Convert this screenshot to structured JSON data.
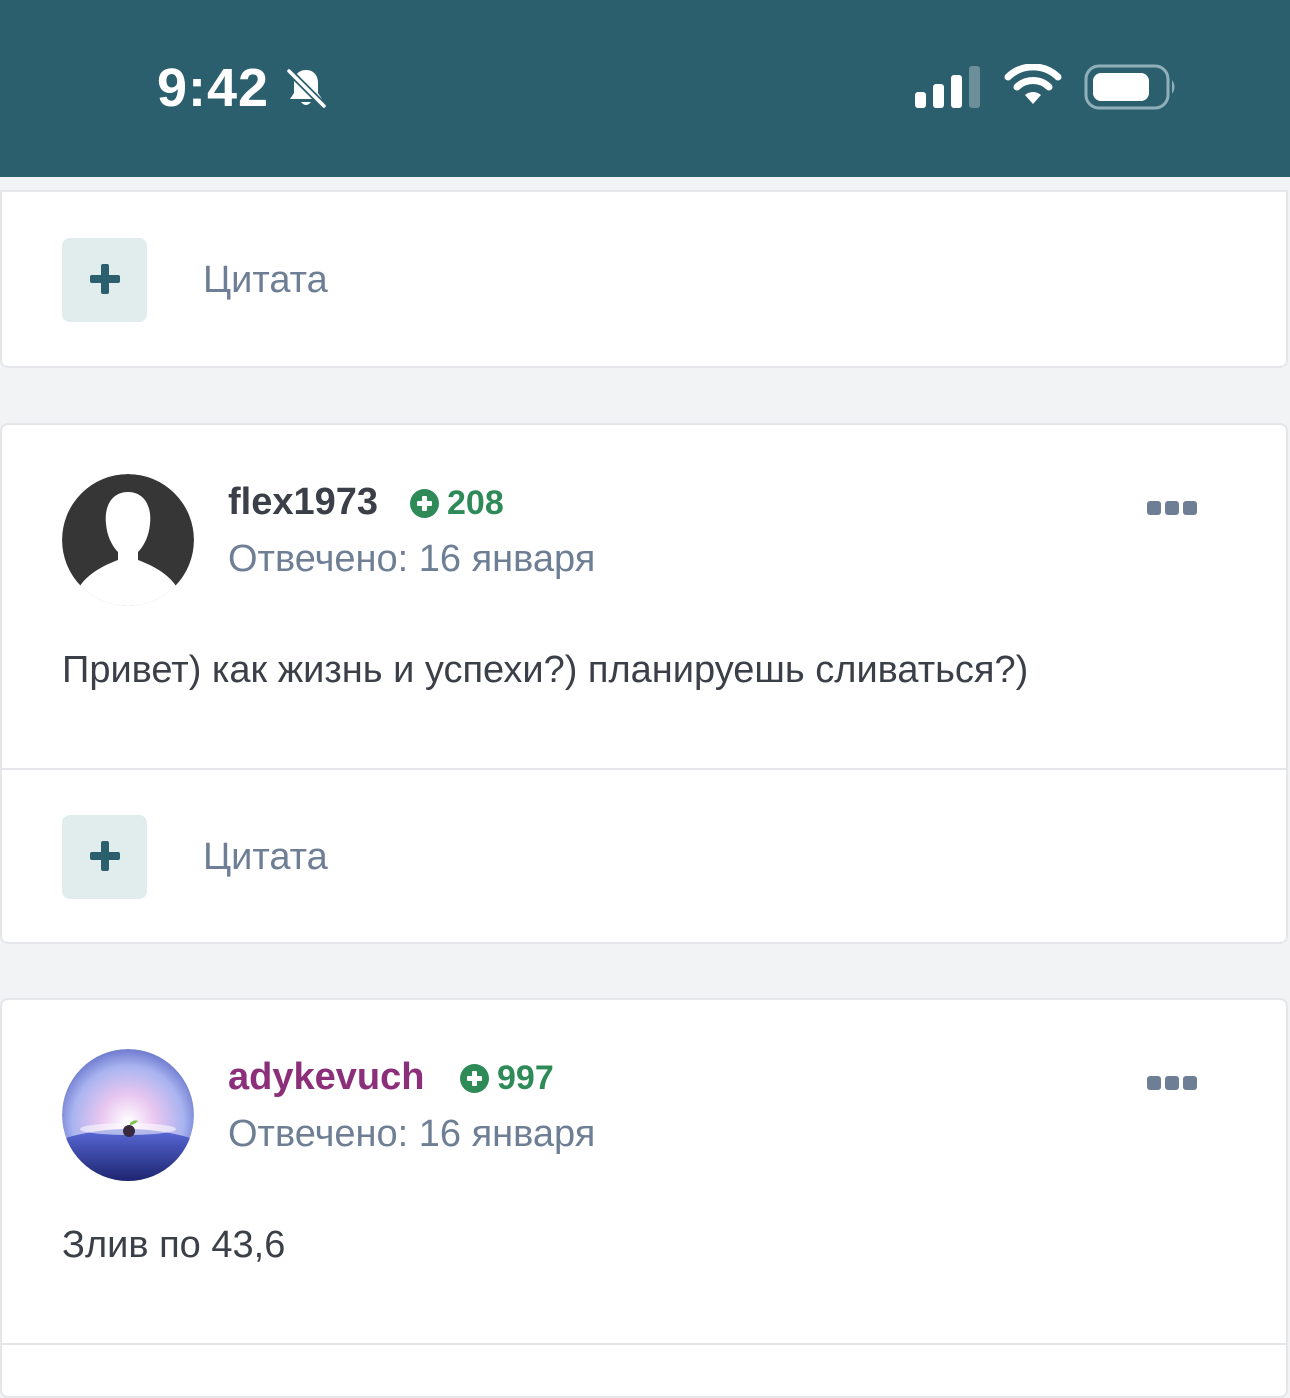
{
  "status_bar": {
    "time": "9:42",
    "icons": [
      "bell-slash-icon",
      "cellular-signal-icon",
      "wifi-icon",
      "battery-icon"
    ],
    "background": "#2b5f6e"
  },
  "quote_block_top": {
    "label": "Цитата",
    "icon": "plus-icon"
  },
  "posts": [
    {
      "author": "flex1973",
      "author_color": "#3b3f47",
      "reputation": "208",
      "meta": "Отвечено: 16 января",
      "text": "Привет) как жизнь и успехи?) планируешь сливаться?)",
      "quote_label": "Цитата",
      "avatar_icon": "default-user-avatar-icon",
      "menu_icon": "more-options-icon"
    },
    {
      "author": "adykevuch",
      "author_color": "#8b2f7a",
      "reputation": "997",
      "meta": "Отвечено: 16 января",
      "text": "Злив по 43,6",
      "avatar_icon": "user-avatar-image-icon",
      "menu_icon": "more-options-icon"
    }
  ],
  "colors": {
    "accent": "#2b5f6e",
    "reputation": "#2e8b57",
    "muted_text": "#6e7f95"
  }
}
